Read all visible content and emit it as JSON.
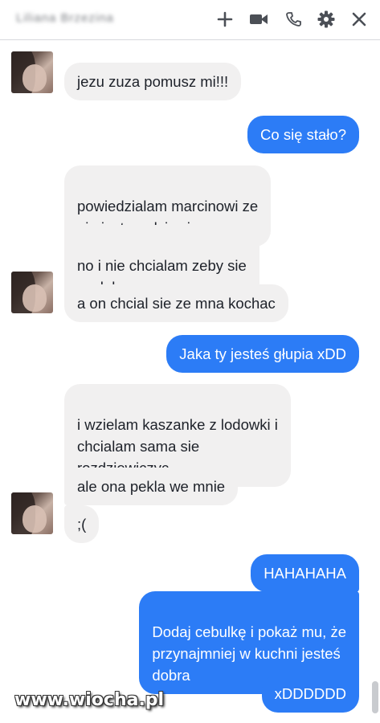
{
  "header": {
    "contact_name": "Liliana Brzezina",
    "icons": [
      "plus-icon",
      "video-icon",
      "phone-icon",
      "gear-icon",
      "close-icon"
    ]
  },
  "messages": [
    {
      "from": "them",
      "text": "jezu zuza pomusz mi!!!"
    },
    {
      "from": "me",
      "text": "Co się stało?"
    },
    {
      "from": "them",
      "text": "powiedzialam marcinowi ze\nnie jestem dziewica"
    },
    {
      "from": "them",
      "text": "no i nie chcialam zeby sie\nwydalo"
    },
    {
      "from": "them",
      "text": "a on chcial sie ze mna kochac"
    },
    {
      "from": "me",
      "text": "Jaka ty jesteś głupia xDD"
    },
    {
      "from": "them",
      "text": "i wzielam kaszanke z lodowki i\nchcialam sama sie\nrozdziewiczyc"
    },
    {
      "from": "them",
      "text": "ale ona pekla we mnie"
    },
    {
      "from": "them",
      "text": ";("
    },
    {
      "from": "me",
      "text": "HAHAHAHA"
    },
    {
      "from": "me",
      "text": "Dodaj cebulkę i pokaż mu, że\nprzynajmniej w kuchni jesteś\ndobra"
    },
    {
      "from": "me",
      "text": "xDDDDDD"
    }
  ],
  "watermark": "www.wiocha.pl",
  "colors": {
    "outgoing_bubble": "#2c7cf6",
    "incoming_bubble": "#f1f0f0",
    "icon": "#4b4f56"
  }
}
